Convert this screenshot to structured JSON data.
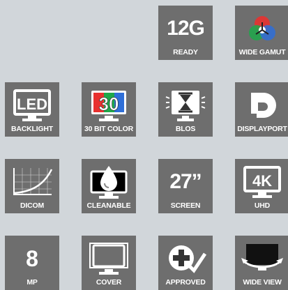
{
  "features": {
    "ready": {
      "big": "12G",
      "label": "READY",
      "icon": "12g-text-icon"
    },
    "wide_gamut": {
      "label": "WIDE GAMUT",
      "icon": "rgb-color-circles-icon"
    },
    "backlight": {
      "big": "LED",
      "label": "BACKLIGHT",
      "icon": "led-monitor-icon"
    },
    "color_30bit": {
      "big": "30",
      "label": "30 BIT COLOR",
      "icon": "30-bit-color-icon",
      "colors": [
        "#e8312f",
        "#1fa84a",
        "#2f6fd8"
      ]
    },
    "blos": {
      "label": "BLOS",
      "icon": "hourglass-monitor-icon"
    },
    "displayport": {
      "label": "DISPLAYPORT",
      "icon": "displayport-logo-icon"
    },
    "dicom": {
      "label": "DICOM",
      "icon": "dicom-curve-graph-icon"
    },
    "cleanable": {
      "label": "CLEANABLE",
      "icon": "water-drop-monitor-icon"
    },
    "screen": {
      "big": "27”",
      "label": "SCREEN",
      "icon": "screen-size-icon"
    },
    "uhd": {
      "big": "4K",
      "label": "UHD",
      "icon": "4k-monitor-icon"
    },
    "mp": {
      "big": "8",
      "label": "MP",
      "icon": "megapixel-icon"
    },
    "cover": {
      "label": "COVER",
      "icon": "monitor-cover-icon"
    },
    "approved": {
      "label": "APPROVED",
      "icon": "medical-cross-check-icon"
    },
    "wide_view": {
      "label": "WIDE VIEW",
      "icon": "wide-view-angle-icon"
    }
  },
  "colors": {
    "tile_bg": "#6e6e6e",
    "page_bg": "#d1d6da",
    "icon": "#ffffff"
  }
}
